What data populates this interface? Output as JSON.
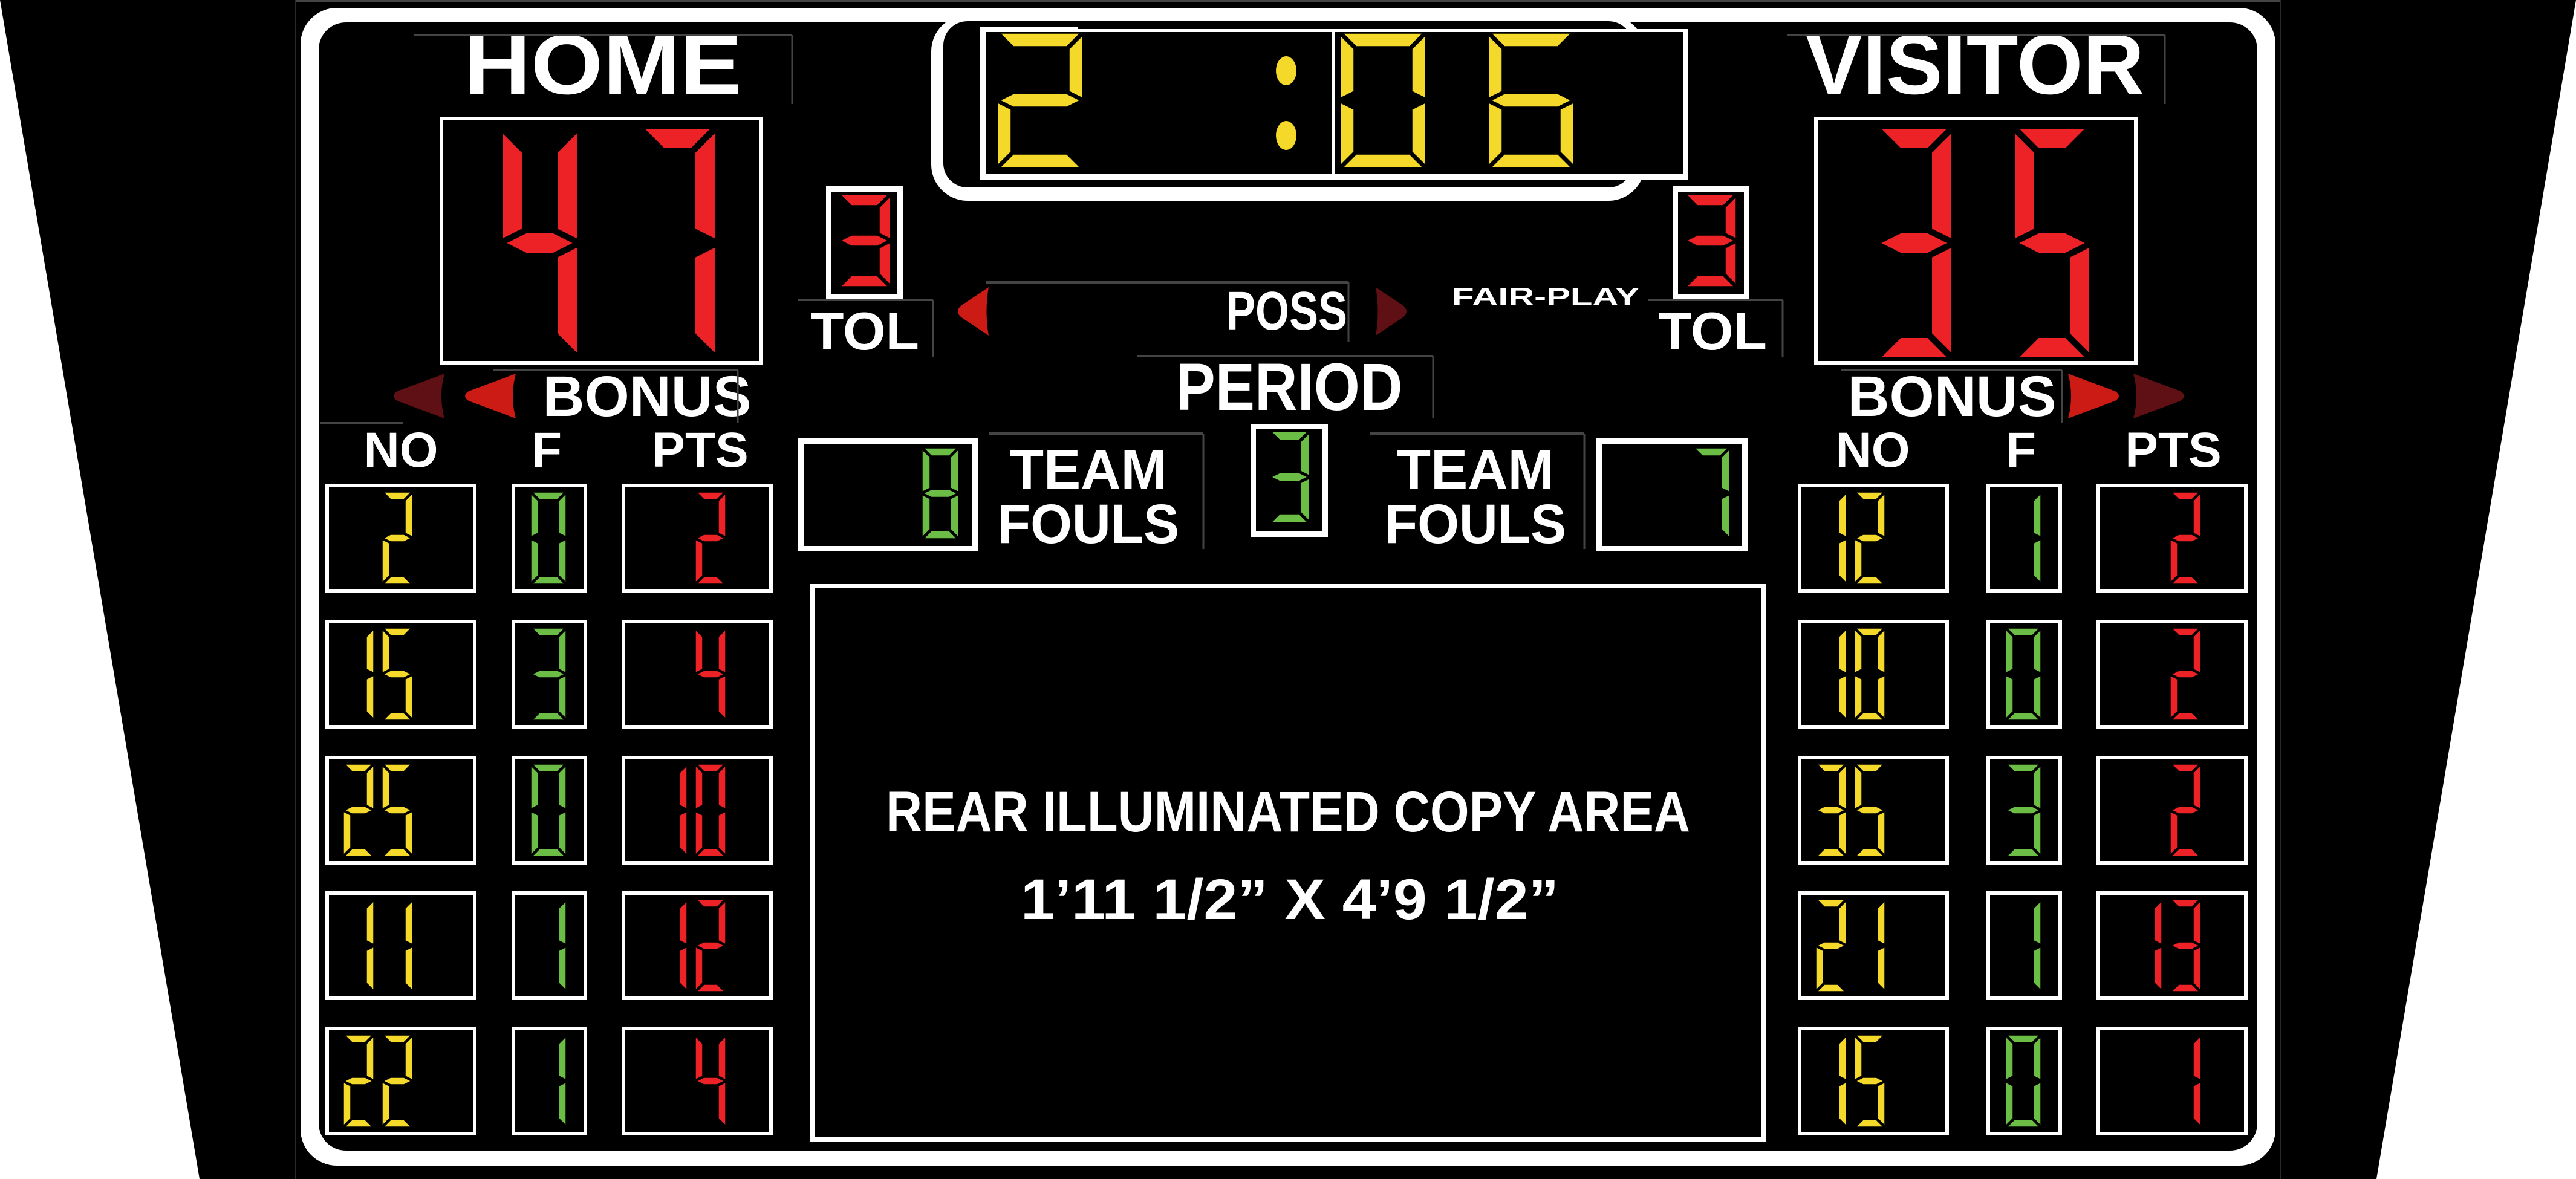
{
  "scoreboard": {
    "home": {
      "label": "HOME",
      "score": "47",
      "timeouts_left": "3",
      "tol_label": "TOL",
      "bonus_label": "BONUS",
      "bonus_indicators": [
        false,
        true
      ],
      "team_fouls": "8",
      "team_fouls_label_1": "TEAM",
      "team_fouls_label_2": "FOULS",
      "players": [
        {
          "no": "2",
          "fouls": "0",
          "pts": "2"
        },
        {
          "no": "15",
          "fouls": "3",
          "pts": "4"
        },
        {
          "no": "25",
          "fouls": "0",
          "pts": "10"
        },
        {
          "no": "11",
          "fouls": "1",
          "pts": "12"
        },
        {
          "no": "22",
          "fouls": "1",
          "pts": "4"
        }
      ]
    },
    "visitor": {
      "label": "VISITOR",
      "score": "35",
      "timeouts_left": "3",
      "tol_label": "TOL",
      "bonus_label": "BONUS",
      "bonus_indicators": [
        true,
        false
      ],
      "team_fouls": "7",
      "team_fouls_label_1": "TEAM",
      "team_fouls_label_2": "FOULS",
      "players": [
        {
          "no": "12",
          "fouls": "1",
          "pts": "2"
        },
        {
          "no": "10",
          "fouls": "0",
          "pts": "2"
        },
        {
          "no": "35",
          "fouls": "3",
          "pts": "2"
        },
        {
          "no": "21",
          "fouls": "1",
          "pts": "13"
        },
        {
          "no": "15",
          "fouls": "0",
          "pts": "1"
        }
      ]
    },
    "clock": {
      "minutes": "2",
      "seconds": "06"
    },
    "period": {
      "label": "PERIOD",
      "value": "3"
    },
    "possession": {
      "label": "POSS",
      "home_active": true,
      "visitor_active": false
    },
    "fair_play_label": "FAIR-PLAY",
    "player_columns": {
      "no": "NO",
      "fouls": "F",
      "pts": "PTS"
    },
    "copy_area": {
      "line1": "REAR ILLUMINATED COPY AREA",
      "line2": "1’11 1/2” X 4’9 1/2”"
    },
    "colors": {
      "score_red": "#ec2227",
      "clock_yellow": "#f5d92a",
      "player_yellow": "#f5d92a",
      "foul_green": "#6cbd45",
      "arrow_active": "#cc1a14",
      "arrow_inactive": "#5e1014"
    }
  }
}
